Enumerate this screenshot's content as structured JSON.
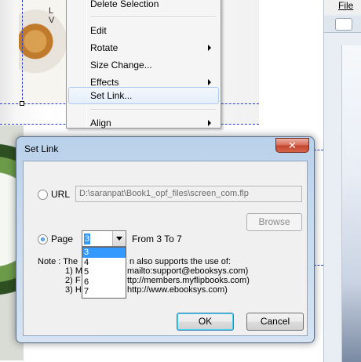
{
  "background": {
    "photo_caption_lines": [
      "L",
      "V"
    ],
    "right_pane": {
      "menu_file": "File"
    }
  },
  "context_menu": {
    "items": [
      {
        "label": "Delete Selection",
        "submenu": false
      },
      {
        "label": "Edit",
        "submenu": false
      },
      {
        "label": "Rotate",
        "submenu": true
      },
      {
        "label": "Size Change...",
        "submenu": false
      },
      {
        "label": "Effects",
        "submenu": true
      },
      {
        "label": "Set Link...",
        "submenu": false,
        "hovered": true
      },
      {
        "label": "Align",
        "submenu": true
      }
    ]
  },
  "dialog": {
    "title": "Set Link",
    "close_glyph": "✕",
    "url_option": {
      "label": "URL",
      "selected": false,
      "value": "D:\\saranpat\\Book1_opf_files\\screen_com.flp"
    },
    "browse_label": "Browse",
    "page_option": {
      "label": "Page",
      "selected": true,
      "current_value": "3",
      "options": [
        "3",
        "4",
        "5",
        "6",
        "7"
      ],
      "range_text": "From 3 To 7"
    },
    "note": {
      "line0_prefix": "Note : The",
      "line0_suffix": "n also supports the use of:",
      "line1_prefix": "1) M",
      "line1_suffix": "mailto:support@ebooksys.com)",
      "line2_prefix": "2) F",
      "line2_suffix": "ttp://members.myflipbooks.com)",
      "line3_prefix": "3) H",
      "line3_suffix": "http://www.ebooksys.com)"
    },
    "ok_label": "OK",
    "cancel_label": "Cancel"
  },
  "colors": {
    "selection_accent": "#3399ff",
    "dialog_frame": "#c4d8ee",
    "close_button": "#c24630",
    "guide_line": "#2a3bd0"
  }
}
